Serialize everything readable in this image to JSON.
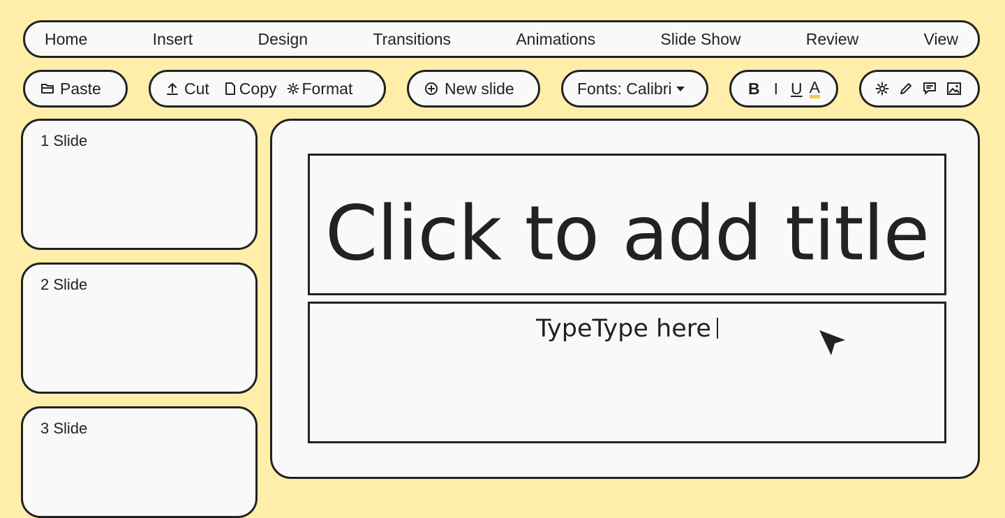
{
  "menu": {
    "items": [
      "Home",
      "Insert",
      "Design",
      "Transitions",
      "Animations",
      "Slide Show",
      "Review",
      "View"
    ]
  },
  "toolbar": {
    "paste_label": "Paste",
    "cut_label": "Cut",
    "copy_label": "Copy",
    "format_label": "Format",
    "new_slide_label": "New slide",
    "fonts_label": "Fonts: Calibri",
    "bold_label": "B",
    "italic_label": "I",
    "underline_label": "U",
    "font_color_label": "A",
    "font_color_accent": "#f7c948",
    "icons": [
      "folder-icon",
      "upload-icon",
      "document-icon",
      "gear-icon",
      "plus-circle-icon",
      "caret-down-icon",
      "settings-icon",
      "pencil-icon",
      "comment-icon",
      "image-icon"
    ]
  },
  "slides": [
    {
      "label": "1 Slide"
    },
    {
      "label": "2 Slide"
    },
    {
      "label": "3 Slide"
    }
  ],
  "editor": {
    "title_placeholder": "Click to add title",
    "body_text": "TypeType here"
  },
  "colors": {
    "background": "#ffeeaa",
    "panel": "#f9f9f9",
    "outline": "#222222",
    "accent": "#f7c948"
  }
}
